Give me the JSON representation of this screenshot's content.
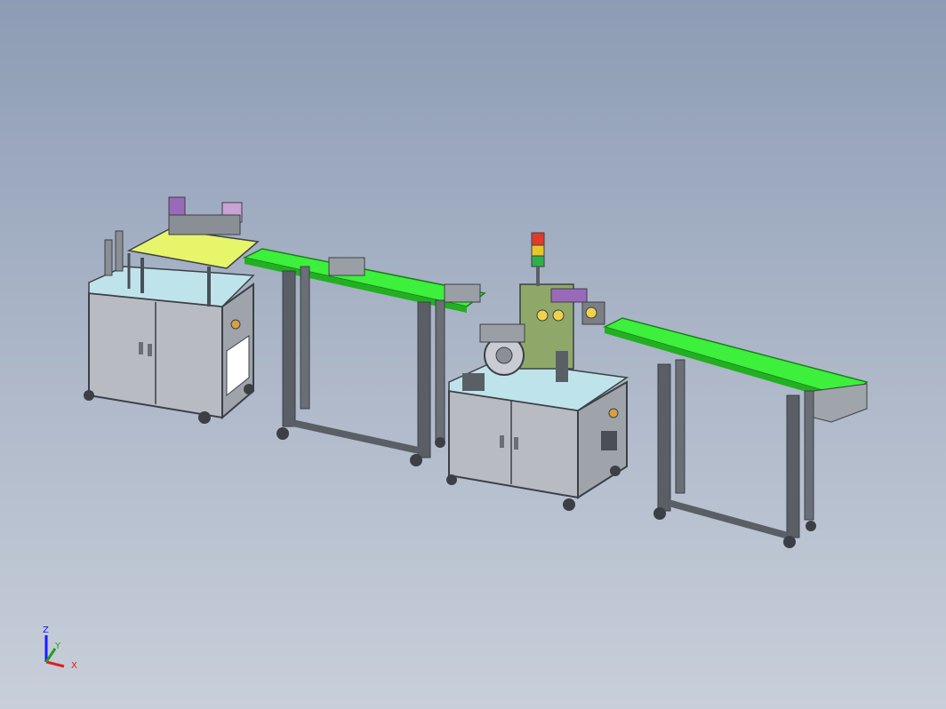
{
  "viewport": {
    "background_top": "#8d9cb4",
    "background_bottom": "#c8cfda"
  },
  "colors": {
    "frame": "#5a5f66",
    "frame_dark": "#3c4046",
    "cabinet_panel": "#b8bcc2",
    "table_top": "#bfe3ea",
    "conveyor_belt": "#3cf03c",
    "conveyor_belt_dark": "#22b022",
    "plate_yellow": "#e6f56a",
    "stack_light_red": "#e23a2a",
    "stack_light_yellow": "#e8c62a",
    "stack_light_green": "#2fb04a",
    "mechanism_green": "#8fa86a",
    "purple_part": "#9a6ab8"
  },
  "triad": {
    "z_label": "Z",
    "y_label": "Y",
    "x_label": "X"
  }
}
